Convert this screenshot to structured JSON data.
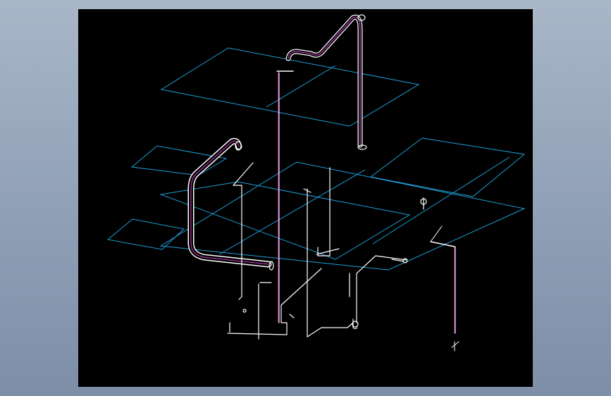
{
  "viewer": {
    "background": "#000000",
    "outer_background": "#9aa8bc"
  },
  "colors": {
    "floor_outline": "#1e9fd6",
    "pipe": "#ffffff",
    "pipe_core": "#d23cc8"
  },
  "text": {}
}
